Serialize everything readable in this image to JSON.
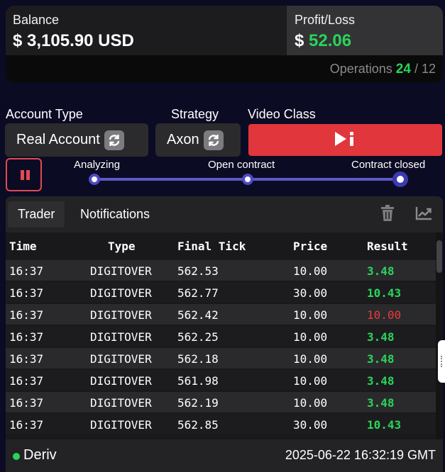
{
  "balance": {
    "label": "Balance",
    "value": "$ 3,105.90 USD"
  },
  "profit_loss": {
    "label": "Profit/Loss",
    "sign": "$",
    "value": "52.06",
    "color": "#2ad35a"
  },
  "operations": {
    "label": "Operations",
    "count": "24",
    "separator": "/",
    "target": "12"
  },
  "controls": {
    "account_type": {
      "label": "Account Type",
      "value": "Real Account",
      "icon": "refresh-icon"
    },
    "strategy": {
      "label": "Strategy",
      "value": "Axon",
      "icon": "refresh-icon"
    },
    "video_class": {
      "label": "Video Class",
      "icon": "play-info-icon",
      "color": "#e0363c"
    }
  },
  "progress": {
    "pause_icon": "pause-icon",
    "steps": [
      {
        "label": "Analyzing"
      },
      {
        "label": "Open contract"
      },
      {
        "label": "Contract closed"
      }
    ],
    "current_step": 3
  },
  "panel": {
    "tabs": [
      {
        "label": "Trader",
        "active": true
      },
      {
        "label": "Notifications",
        "active": false
      }
    ],
    "tools": [
      "trash-icon",
      "trend-chart-icon"
    ],
    "table": {
      "headers": [
        "Time",
        "Type",
        "Final Tick",
        "Price",
        "Result"
      ],
      "rows": [
        {
          "time": "16:37",
          "type": "DIGITOVER",
          "tick": "562.53",
          "price": "10.00",
          "result": "3.48",
          "status": "win"
        },
        {
          "time": "16:37",
          "type": "DIGITOVER",
          "tick": "562.77",
          "price": "30.00",
          "result": "10.43",
          "status": "win"
        },
        {
          "time": "16:37",
          "type": "DIGITOVER",
          "tick": "562.42",
          "price": "10.00",
          "result": "10.00",
          "status": "loss"
        },
        {
          "time": "16:37",
          "type": "DIGITOVER",
          "tick": "562.25",
          "price": "10.00",
          "result": "3.48",
          "status": "win"
        },
        {
          "time": "16:37",
          "type": "DIGITOVER",
          "tick": "562.18",
          "price": "10.00",
          "result": "3.48",
          "status": "win"
        },
        {
          "time": "16:37",
          "type": "DIGITOVER",
          "tick": "561.98",
          "price": "10.00",
          "result": "3.48",
          "status": "win"
        },
        {
          "time": "16:37",
          "type": "DIGITOVER",
          "tick": "562.19",
          "price": "10.00",
          "result": "3.48",
          "status": "win"
        },
        {
          "time": "16:37",
          "type": "DIGITOVER",
          "tick": "562.85",
          "price": "30.00",
          "result": "10.43",
          "status": "win"
        }
      ]
    }
  },
  "footer": {
    "status": "Deriv",
    "status_color": "#2ad35a",
    "timestamp": "2025-06-22 16:32:19 GMT"
  }
}
